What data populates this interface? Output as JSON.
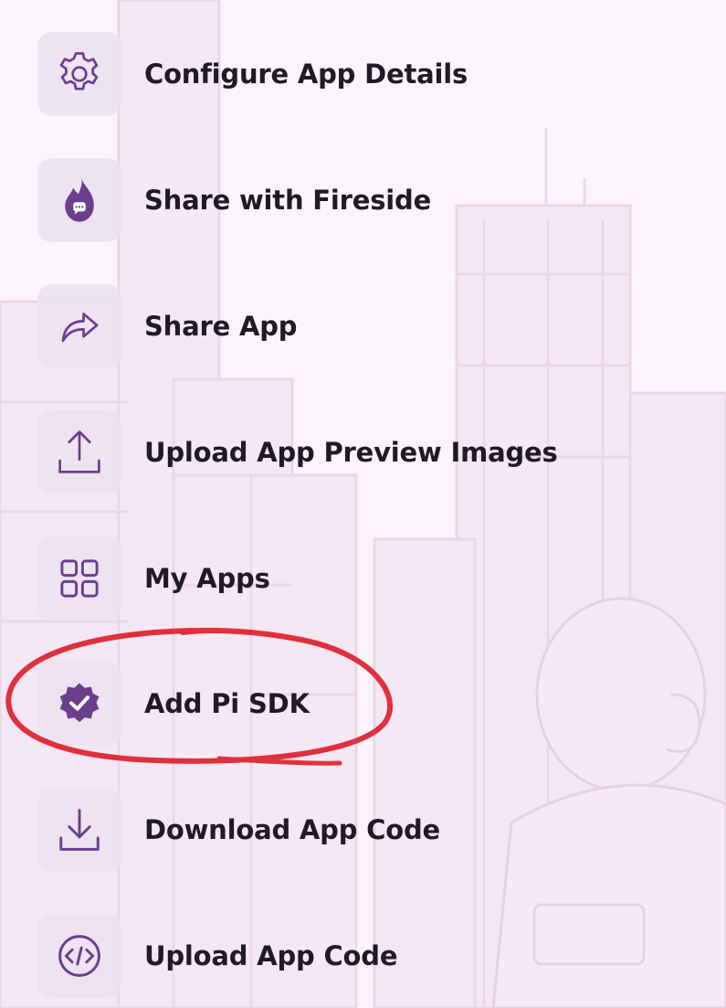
{
  "colors": {
    "accent": "#6b3e8e",
    "tile": "#ece2f0",
    "text": "#1f1a26",
    "background": "#fbf4fb",
    "annotation": "#e0303c"
  },
  "menu": {
    "items": [
      {
        "label": "Configure App Details",
        "icon": "gear-icon"
      },
      {
        "label": "Share with Fireside",
        "icon": "fireside-flame-icon"
      },
      {
        "label": "Share App",
        "icon": "share-arrow-icon"
      },
      {
        "label": "Upload App Preview Images",
        "icon": "upload-icon"
      },
      {
        "label": "My Apps",
        "icon": "grid-icon"
      },
      {
        "label": "Add Pi SDK",
        "icon": "verified-badge-icon"
      },
      {
        "label": "Download App Code",
        "icon": "download-icon"
      },
      {
        "label": "Upload App Code",
        "icon": "code-icon"
      }
    ]
  }
}
